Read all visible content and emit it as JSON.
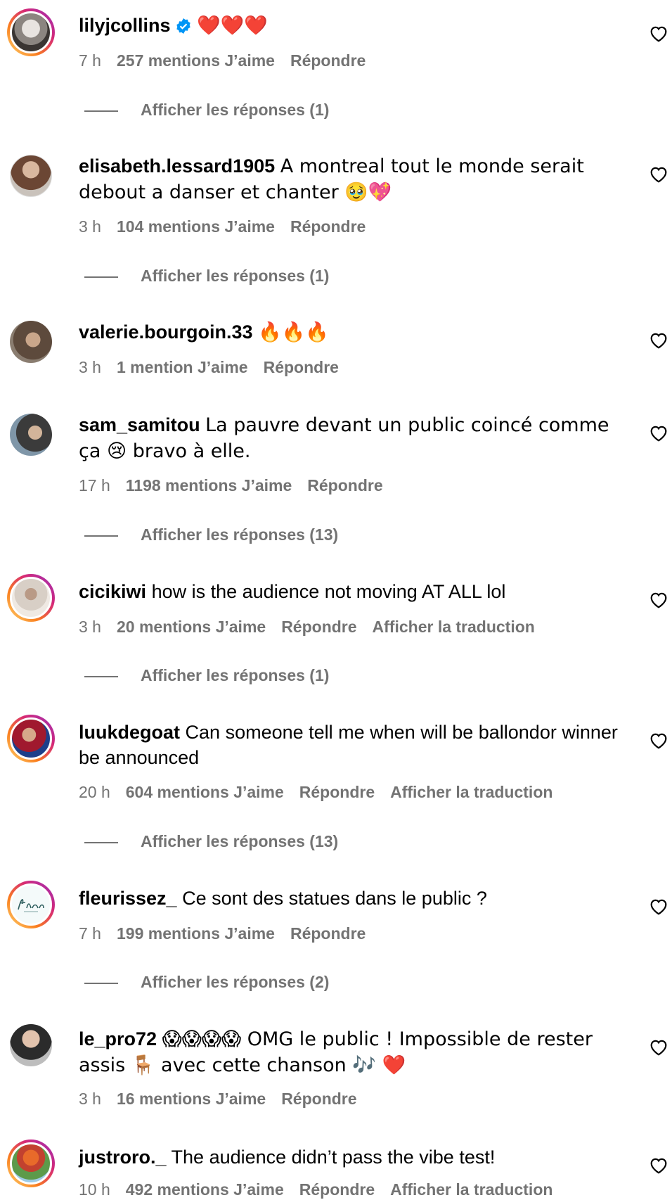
{
  "comments": [
    {
      "username": "lilyjcollins",
      "verified": true,
      "text": "❤️❤️❤️",
      "time": "7 h",
      "likes": "257 mentions J’aime",
      "reply": "Répondre",
      "translate": "",
      "view_replies": "Afficher les réponses (1)"
    },
    {
      "username": "elisabeth.lessard1905",
      "text": "A montreal tout le monde serait debout a danser et chanter 🥹💖",
      "time": "3 h",
      "likes": "104 mentions J’aime",
      "reply": "Répondre",
      "translate": "",
      "view_replies": "Afficher les réponses (1)"
    },
    {
      "username": "valerie.bourgoin.33",
      "text": "🔥🔥🔥",
      "time": "3 h",
      "likes": "1 mention J’aime",
      "reply": "Répondre",
      "translate": "",
      "view_replies": ""
    },
    {
      "username": "sam_samitou",
      "text": "La pauvre devant un public coincé comme ça 😢 bravo à elle.",
      "time": "17 h",
      "likes": "1198 mentions J’aime",
      "reply": "Répondre",
      "translate": "",
      "view_replies": "Afficher les réponses (13)"
    },
    {
      "username": "cicikiwi",
      "text": "how is the audience not moving AT ALL lol",
      "time": "3 h",
      "likes": "20 mentions J’aime",
      "reply": "Répondre",
      "translate": "Afficher la traduction",
      "view_replies": "Afficher les réponses (1)"
    },
    {
      "username": "luukdegoat",
      "text": "Can someone tell me when will be ballondor winner be announced",
      "time": "20 h",
      "likes": "604 mentions J’aime",
      "reply": "Répondre",
      "translate": "Afficher la traduction",
      "view_replies": "Afficher les réponses (13)"
    },
    {
      "username": "fleurissez_",
      "text": "Ce sont des statues dans le public ?",
      "time": "7 h",
      "likes": "199 mentions J’aime",
      "reply": "Répondre",
      "translate": "",
      "view_replies": "Afficher les réponses (2)"
    },
    {
      "username": "le_pro72",
      "text": "😱😱😱😱 OMG le public ! Impossible de rester assis 🪑 avec cette chanson 🎶 ❤️",
      "time": "3 h",
      "likes": "16 mentions J’aime",
      "reply": "Répondre",
      "translate": "",
      "view_replies": ""
    },
    {
      "username": "justroro._",
      "text": "The audience didn’t pass the vibe test!",
      "time": "10 h",
      "likes": "492 mentions J’aime",
      "reply": "Répondre",
      "translate": "Afficher la traduction",
      "view_replies": ""
    }
  ],
  "icons": {
    "like": "heart-outline-icon",
    "verified": "verified-badge-icon"
  },
  "colors": {
    "meta": "#737373",
    "verified": "#0095f6",
    "story_ring": [
      "#feda75",
      "#fa7e1e",
      "#d62976",
      "#962fbf"
    ]
  }
}
